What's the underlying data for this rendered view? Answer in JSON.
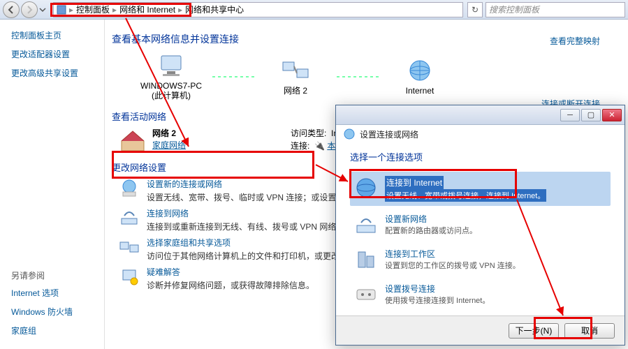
{
  "breadcrumb": {
    "seg1": "控制面板",
    "seg2": "网络和 Internet",
    "seg3": "网络和共享中心"
  },
  "search": {
    "placeholder": "搜索控制面板"
  },
  "sidebar": {
    "home": "控制面板主页",
    "adapter": "更改适配器设置",
    "advanced": "更改高级共享设置",
    "see_also": "另请参阅",
    "internet_options": "Internet 选项",
    "firewall": "Windows 防火墙",
    "homegroup": "家庭组"
  },
  "main": {
    "title": "查看基本网络信息并设置连接",
    "see_full_map": "查看完整映射",
    "node_pc": "WINDOWS7-PC",
    "node_pc_sub": "(此计算机)",
    "node_net": "网络 2",
    "node_internet": "Internet",
    "view_active": "查看活动网络",
    "connect_or_disconnect": "连接或断开连接",
    "active_name": "网络 2",
    "active_type": "家庭网络",
    "access_type_label": "访问类型:",
    "access_type_value": "Internet",
    "connection_label": "连接:",
    "connection_value": "本地连接",
    "change_settings": "更改网络设置",
    "task1_title": "设置新的连接或网络",
    "task1_desc": "设置无线、宽带、拨号、临时或 VPN 连接；或设置路由器或访问点。",
    "task2_title": "连接到网络",
    "task2_desc": "连接到或重新连接到无线、有线、拨号或 VPN 网络连接。",
    "task3_title": "选择家庭组和共享选项",
    "task3_desc": "访问位于其他网络计算机上的文件和打印机，或更改共享设置。",
    "task4_title": "疑难解答",
    "task4_desc": "诊断并修复网络问题，或获得故障排除信息。"
  },
  "dialog": {
    "header": "设置连接或网络",
    "title": "选择一个连接选项",
    "opt1_title": "连接到 Internet",
    "opt1_desc": "设置无线、宽带或拨号连接，连接到 Internet。",
    "opt2_title": "设置新网络",
    "opt2_desc": "配置新的路由器或访问点。",
    "opt3_title": "连接到工作区",
    "opt3_desc": "设置到您的工作区的拨号或 VPN 连接。",
    "opt4_title": "设置拨号连接",
    "opt4_desc": "使用拨号连接连接到 Internet。",
    "next": "下一步(N)",
    "cancel": "取消"
  }
}
